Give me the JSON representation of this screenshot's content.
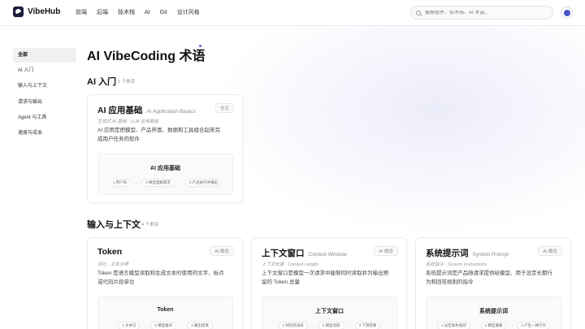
{
  "app": {
    "name": "VibeHub"
  },
  "nav": [
    {
      "label": "前端"
    },
    {
      "label": "后端"
    },
    {
      "label": "技术栈"
    },
    {
      "label": "AI",
      "active": true
    },
    {
      "label": "Git"
    },
    {
      "label": "设计风格"
    }
  ],
  "search": {
    "placeholder": "搜索组件、技术栈、AI 术语..."
  },
  "sidebar": {
    "items": [
      {
        "label": "全部",
        "active": true
      },
      {
        "label": "AI 入门"
      },
      {
        "label": "输入与上下文"
      },
      {
        "label": "请求与输出"
      },
      {
        "label": "Agent 与工具"
      },
      {
        "label": "速度与成本"
      }
    ]
  },
  "page": {
    "title": "AI VibeCoding 术语"
  },
  "sections": [
    {
      "title": "AI 入门",
      "count": "1 个条目",
      "cards": [
        {
          "title": "AI 应用基础",
          "en": "AI Application Basics",
          "badge": "仓见",
          "sub": "生成式 AI 基础 · LLM 应用基础",
          "desc": [
            "AI 应用是把模型、产品界面、数据和工具组合起来完",
            "成用户任务的软件"
          ],
          "preview_title": "AI 应用基础",
          "steps": [
            "1 用户目",
            "2 模型理解需求",
            "3 产品执行并输出"
          ]
        }
      ]
    },
    {
      "title": "输入与上下文",
      "count": "4 个条目",
      "cards": [
        {
          "title": "Token",
          "en": "",
          "badge": "AI 概念",
          "sub": "词元 · 文本令牌",
          "desc": [
            "Token 是语言模型读取和生成文本时使用的文字、标点",
            "或代码片段单位"
          ],
          "preview_title": "Token",
          "steps": [
            "1 文本切",
            "2 模型推导",
            "3 输出结果"
          ]
        },
        {
          "title": "上下文窗口",
          "en": "Context Window",
          "badge": "AI 概念",
          "sub": "上下文长度 · Context Length",
          "desc": [
            "上下文窗口是模型一次请求中能够同时读取并为输出预",
            "留的 Token 总量"
          ],
          "preview_title": "上下文窗口",
          "steps": [
            "1 材料装进去",
            "2 模型读取",
            "3 下游结果"
          ]
        },
        {
          "title": "系统提示词",
          "en": "System Prompt",
          "badge": "AI 概念",
          "sub": "系统指令 · System Instructions",
          "desc": [
            "系统提示词是产品随请求提供给模型、用于设定长期行",
            "为和回答规则的指令"
          ],
          "preview_title": "系统提示词",
          "steps": [
            "1 设定角色规则",
            "2 模型遵循",
            "3 产生一致行为"
          ]
        }
      ]
    }
  ]
}
